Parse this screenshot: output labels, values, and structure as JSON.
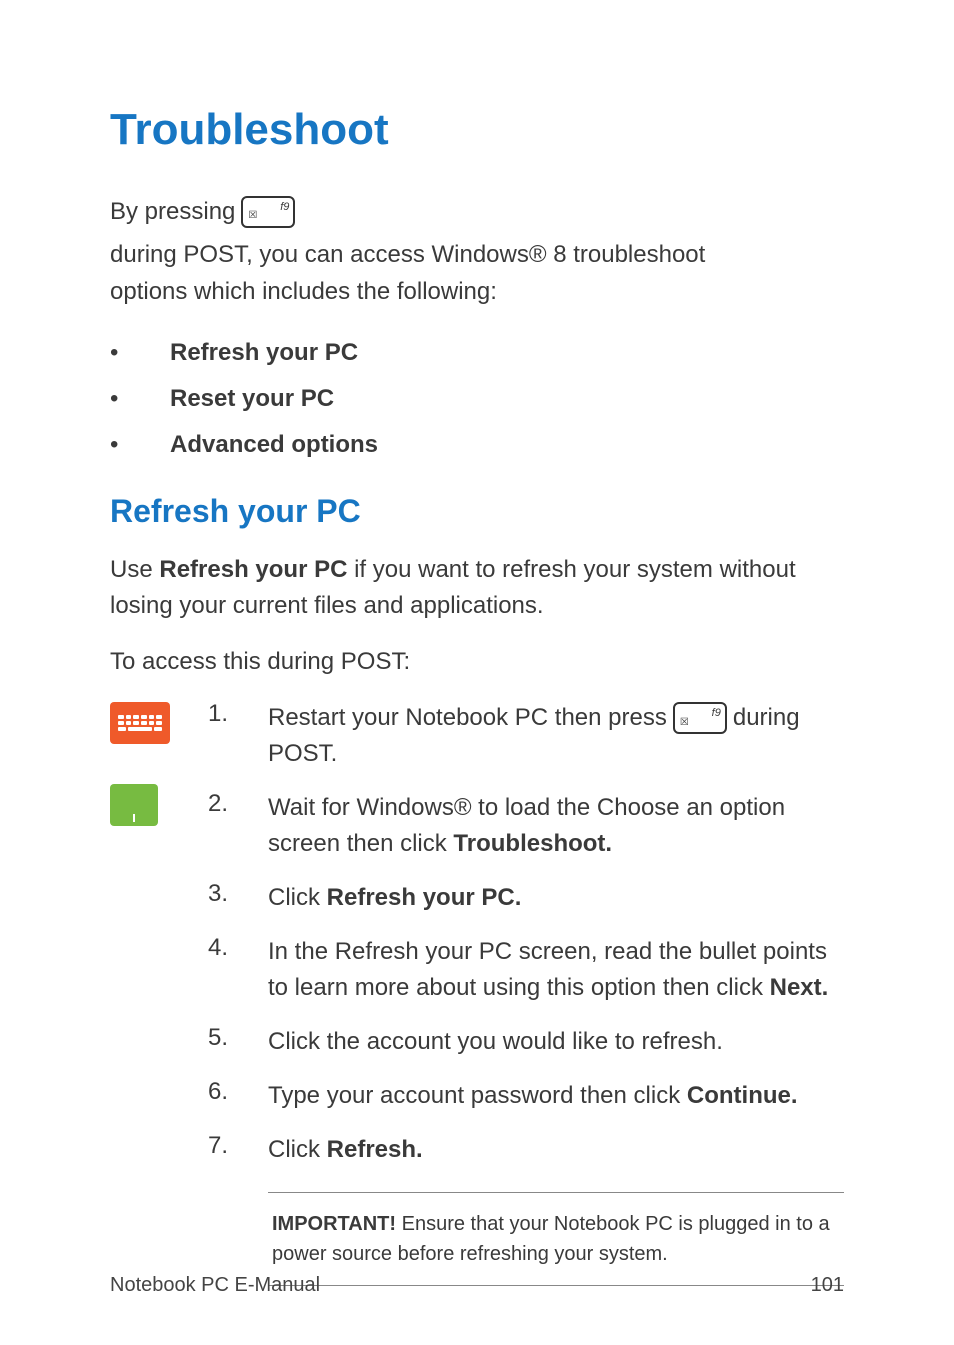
{
  "heading": "Troubleshoot",
  "intro": {
    "prefix": "By pressing",
    "key_label": "f9",
    "key_sub": "☒",
    "suffix1": "during POST, you can access Windows® 8 troubleshoot",
    "line2": "options which includes the following:"
  },
  "options": [
    "Refresh your PC",
    "Reset your PC",
    "Advanced options"
  ],
  "section_heading": "Refresh your PC",
  "section_para": {
    "pre": "Use ",
    "bold": "Refresh your PC",
    "post": " if you want to refresh your system without losing your current files and applications."
  },
  "access_line": "To access this during POST:",
  "key2": {
    "label": "f9",
    "sub": "☒"
  },
  "steps": [
    {
      "num": "1.",
      "pre": "Restart your Notebook PC then press",
      "post": "during",
      "line2": "POST."
    },
    {
      "num": "2.",
      "text_pre": "Wait for Windows® to load the Choose an option screen then click ",
      "bold": "Troubleshoot."
    },
    {
      "num": "3.",
      "text_pre": "Click ",
      "bold": "Refresh your PC."
    },
    {
      "num": "4.",
      "text_pre": "In the Refresh your PC screen, read the bullet points to learn more about using this option then click ",
      "bold": "Next."
    },
    {
      "num": "5.",
      "text_pre": "Click the account you would like to refresh."
    },
    {
      "num": "6.",
      "text_pre": "Type your account password then click ",
      "bold": "Continue."
    },
    {
      "num": "7.",
      "text_pre": "Click ",
      "bold": "Refresh."
    }
  ],
  "note": {
    "bold": "IMPORTANT!",
    "text": " Ensure that your Notebook PC is plugged in to a power source before refreshing your system."
  },
  "footer": {
    "left": "Notebook PC E-Manual",
    "right": "101"
  }
}
